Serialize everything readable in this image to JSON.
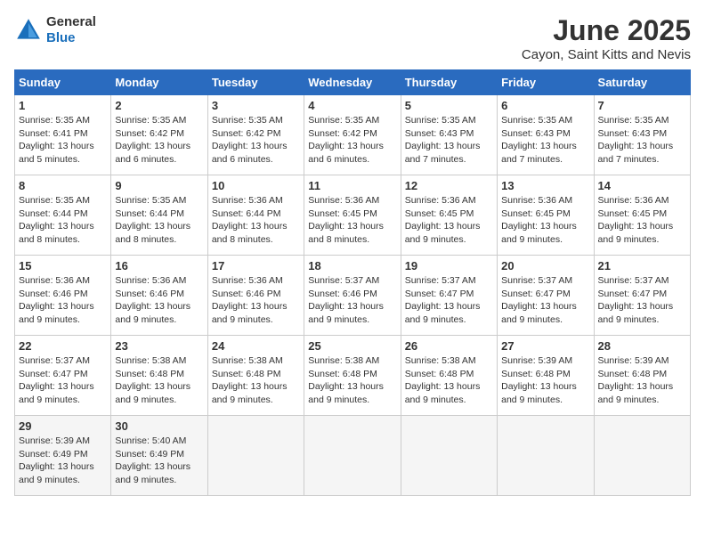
{
  "logo": {
    "text_general": "General",
    "text_blue": "Blue"
  },
  "title": "June 2025",
  "location": "Cayon, Saint Kitts and Nevis",
  "days_of_week": [
    "Sunday",
    "Monday",
    "Tuesday",
    "Wednesday",
    "Thursday",
    "Friday",
    "Saturday"
  ],
  "weeks": [
    [
      {
        "day": "1",
        "sunrise": "Sunrise: 5:35 AM",
        "sunset": "Sunset: 6:41 PM",
        "daylight": "Daylight: 13 hours and 5 minutes."
      },
      {
        "day": "2",
        "sunrise": "Sunrise: 5:35 AM",
        "sunset": "Sunset: 6:42 PM",
        "daylight": "Daylight: 13 hours and 6 minutes."
      },
      {
        "day": "3",
        "sunrise": "Sunrise: 5:35 AM",
        "sunset": "Sunset: 6:42 PM",
        "daylight": "Daylight: 13 hours and 6 minutes."
      },
      {
        "day": "4",
        "sunrise": "Sunrise: 5:35 AM",
        "sunset": "Sunset: 6:42 PM",
        "daylight": "Daylight: 13 hours and 6 minutes."
      },
      {
        "day": "5",
        "sunrise": "Sunrise: 5:35 AM",
        "sunset": "Sunset: 6:43 PM",
        "daylight": "Daylight: 13 hours and 7 minutes."
      },
      {
        "day": "6",
        "sunrise": "Sunrise: 5:35 AM",
        "sunset": "Sunset: 6:43 PM",
        "daylight": "Daylight: 13 hours and 7 minutes."
      },
      {
        "day": "7",
        "sunrise": "Sunrise: 5:35 AM",
        "sunset": "Sunset: 6:43 PM",
        "daylight": "Daylight: 13 hours and 7 minutes."
      }
    ],
    [
      {
        "day": "8",
        "sunrise": "Sunrise: 5:35 AM",
        "sunset": "Sunset: 6:44 PM",
        "daylight": "Daylight: 13 hours and 8 minutes."
      },
      {
        "day": "9",
        "sunrise": "Sunrise: 5:35 AM",
        "sunset": "Sunset: 6:44 PM",
        "daylight": "Daylight: 13 hours and 8 minutes."
      },
      {
        "day": "10",
        "sunrise": "Sunrise: 5:36 AM",
        "sunset": "Sunset: 6:44 PM",
        "daylight": "Daylight: 13 hours and 8 minutes."
      },
      {
        "day": "11",
        "sunrise": "Sunrise: 5:36 AM",
        "sunset": "Sunset: 6:45 PM",
        "daylight": "Daylight: 13 hours and 8 minutes."
      },
      {
        "day": "12",
        "sunrise": "Sunrise: 5:36 AM",
        "sunset": "Sunset: 6:45 PM",
        "daylight": "Daylight: 13 hours and 9 minutes."
      },
      {
        "day": "13",
        "sunrise": "Sunrise: 5:36 AM",
        "sunset": "Sunset: 6:45 PM",
        "daylight": "Daylight: 13 hours and 9 minutes."
      },
      {
        "day": "14",
        "sunrise": "Sunrise: 5:36 AM",
        "sunset": "Sunset: 6:45 PM",
        "daylight": "Daylight: 13 hours and 9 minutes."
      }
    ],
    [
      {
        "day": "15",
        "sunrise": "Sunrise: 5:36 AM",
        "sunset": "Sunset: 6:46 PM",
        "daylight": "Daylight: 13 hours and 9 minutes."
      },
      {
        "day": "16",
        "sunrise": "Sunrise: 5:36 AM",
        "sunset": "Sunset: 6:46 PM",
        "daylight": "Daylight: 13 hours and 9 minutes."
      },
      {
        "day": "17",
        "sunrise": "Sunrise: 5:36 AM",
        "sunset": "Sunset: 6:46 PM",
        "daylight": "Daylight: 13 hours and 9 minutes."
      },
      {
        "day": "18",
        "sunrise": "Sunrise: 5:37 AM",
        "sunset": "Sunset: 6:46 PM",
        "daylight": "Daylight: 13 hours and 9 minutes."
      },
      {
        "day": "19",
        "sunrise": "Sunrise: 5:37 AM",
        "sunset": "Sunset: 6:47 PM",
        "daylight": "Daylight: 13 hours and 9 minutes."
      },
      {
        "day": "20",
        "sunrise": "Sunrise: 5:37 AM",
        "sunset": "Sunset: 6:47 PM",
        "daylight": "Daylight: 13 hours and 9 minutes."
      },
      {
        "day": "21",
        "sunrise": "Sunrise: 5:37 AM",
        "sunset": "Sunset: 6:47 PM",
        "daylight": "Daylight: 13 hours and 9 minutes."
      }
    ],
    [
      {
        "day": "22",
        "sunrise": "Sunrise: 5:37 AM",
        "sunset": "Sunset: 6:47 PM",
        "daylight": "Daylight: 13 hours and 9 minutes."
      },
      {
        "day": "23",
        "sunrise": "Sunrise: 5:38 AM",
        "sunset": "Sunset: 6:48 PM",
        "daylight": "Daylight: 13 hours and 9 minutes."
      },
      {
        "day": "24",
        "sunrise": "Sunrise: 5:38 AM",
        "sunset": "Sunset: 6:48 PM",
        "daylight": "Daylight: 13 hours and 9 minutes."
      },
      {
        "day": "25",
        "sunrise": "Sunrise: 5:38 AM",
        "sunset": "Sunset: 6:48 PM",
        "daylight": "Daylight: 13 hours and 9 minutes."
      },
      {
        "day": "26",
        "sunrise": "Sunrise: 5:38 AM",
        "sunset": "Sunset: 6:48 PM",
        "daylight": "Daylight: 13 hours and 9 minutes."
      },
      {
        "day": "27",
        "sunrise": "Sunrise: 5:39 AM",
        "sunset": "Sunset: 6:48 PM",
        "daylight": "Daylight: 13 hours and 9 minutes."
      },
      {
        "day": "28",
        "sunrise": "Sunrise: 5:39 AM",
        "sunset": "Sunset: 6:48 PM",
        "daylight": "Daylight: 13 hours and 9 minutes."
      }
    ],
    [
      {
        "day": "29",
        "sunrise": "Sunrise: 5:39 AM",
        "sunset": "Sunset: 6:49 PM",
        "daylight": "Daylight: 13 hours and 9 minutes."
      },
      {
        "day": "30",
        "sunrise": "Sunrise: 5:40 AM",
        "sunset": "Sunset: 6:49 PM",
        "daylight": "Daylight: 13 hours and 9 minutes."
      },
      null,
      null,
      null,
      null,
      null
    ]
  ]
}
